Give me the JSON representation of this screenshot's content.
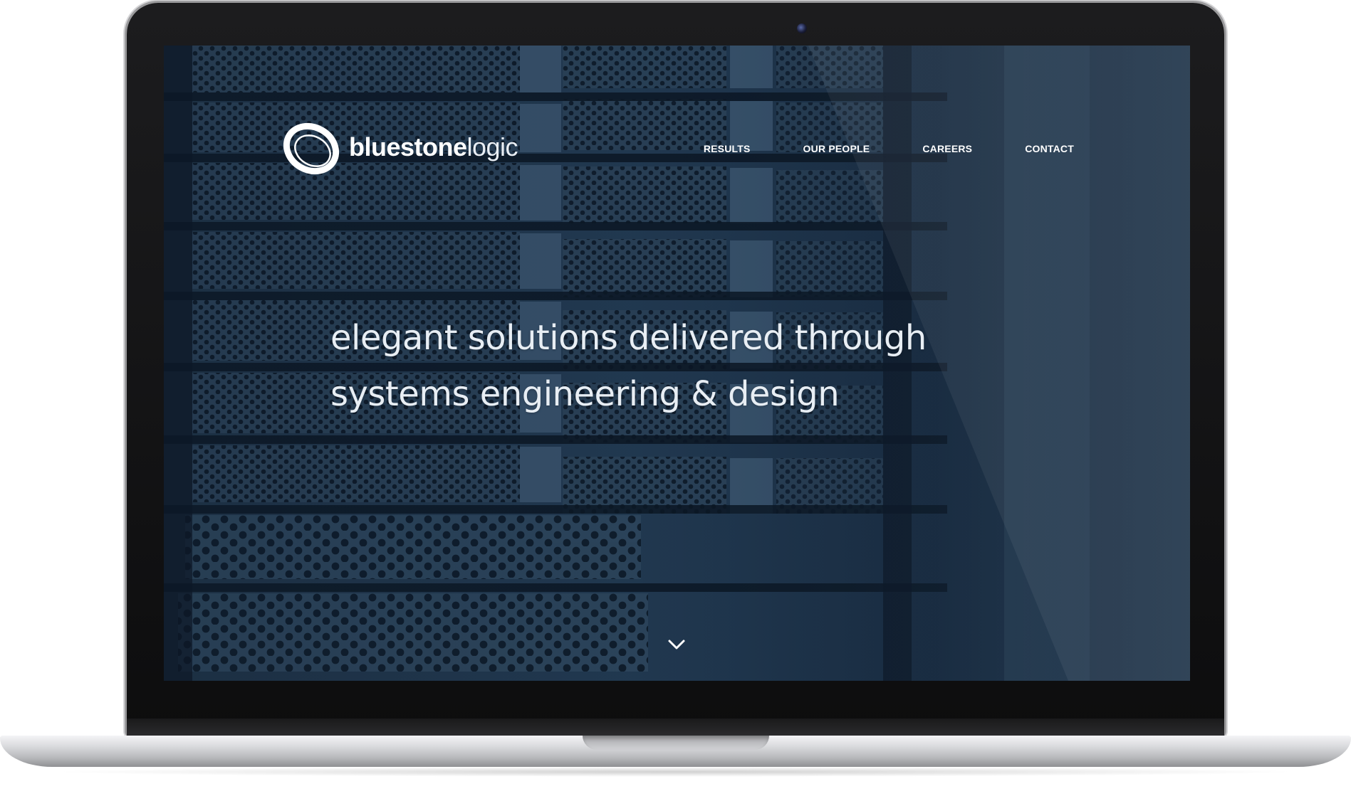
{
  "site": {
    "logo": {
      "word_bold": "bluestone",
      "word_light": "logic",
      "mark_icon": "ring-logo-icon"
    },
    "nav": [
      {
        "label": "RESULTS"
      },
      {
        "label": "OUR PEOPLE"
      },
      {
        "label": "CAREERS"
      },
      {
        "label": "CONTACT"
      }
    ],
    "hero": {
      "line1": "elegant solutions delivered through",
      "line2": "systems engineering & design"
    },
    "scroll_icon": "chevron-down-icon"
  },
  "colors": {
    "screen_bg": "#152538",
    "text": "#ffffff",
    "laptop_bezel": "#0d0d0e",
    "laptop_aluminium": "#c8c9cc"
  }
}
